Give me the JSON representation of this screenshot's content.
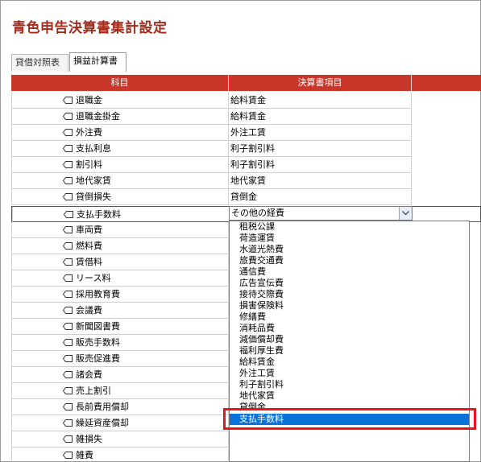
{
  "page": {
    "title": "青色申告決算書集計設定"
  },
  "tabs": [
    {
      "label": "貸借対照表",
      "active": false
    },
    {
      "label": "損益計算書",
      "active": true
    }
  ],
  "table": {
    "headers": [
      "科目",
      "決算書項目"
    ],
    "rows": [
      {
        "account": "退職金",
        "item": "給料賃金"
      },
      {
        "account": "退職金掛金",
        "item": "給料賃金"
      },
      {
        "account": "外注費",
        "item": "外注工賃"
      },
      {
        "account": "支払利息",
        "item": "利子割引料"
      },
      {
        "account": "割引料",
        "item": "利子割引料"
      },
      {
        "account": "地代家賃",
        "item": "地代家賃"
      },
      {
        "account": "貸倒損失",
        "item": "貸倒金"
      },
      {
        "account": "支払手数料",
        "item": ""
      },
      {
        "account": "車両費",
        "item": ""
      },
      {
        "account": "燃料費",
        "item": ""
      },
      {
        "account": "賃借料",
        "item": ""
      },
      {
        "account": "リース料",
        "item": ""
      },
      {
        "account": "採用教育費",
        "item": ""
      },
      {
        "account": "会議費",
        "item": ""
      },
      {
        "account": "新聞図書費",
        "item": ""
      },
      {
        "account": "販売手数料",
        "item": ""
      },
      {
        "account": "販売促進費",
        "item": ""
      },
      {
        "account": "諸会費",
        "item": ""
      },
      {
        "account": "売上割引",
        "item": ""
      },
      {
        "account": "長前費用償却",
        "item": ""
      },
      {
        "account": "繰延資産償却",
        "item": ""
      },
      {
        "account": "雑損失",
        "item": ""
      },
      {
        "account": "雑費",
        "item": ""
      }
    ]
  },
  "dropdown": {
    "selected_value": "その他の経費",
    "options": [
      "租税公課",
      "荷造運賃",
      "水道光熱費",
      "旅費交通費",
      "通信費",
      "広告宣伝費",
      "接待交際費",
      "損害保険料",
      "修繕費",
      "消耗品費",
      "減価償却費",
      "福利厚生費",
      "給料賃金",
      "外注工賃",
      "利子割引料",
      "地代家賃",
      "貸倒金",
      "支払手数料"
    ],
    "highlighted": "支払手数料"
  },
  "colors": {
    "accent": "#c8372a",
    "title": "#a52a1a",
    "highlight": "#0a73d9",
    "callout": "#e8141a"
  }
}
